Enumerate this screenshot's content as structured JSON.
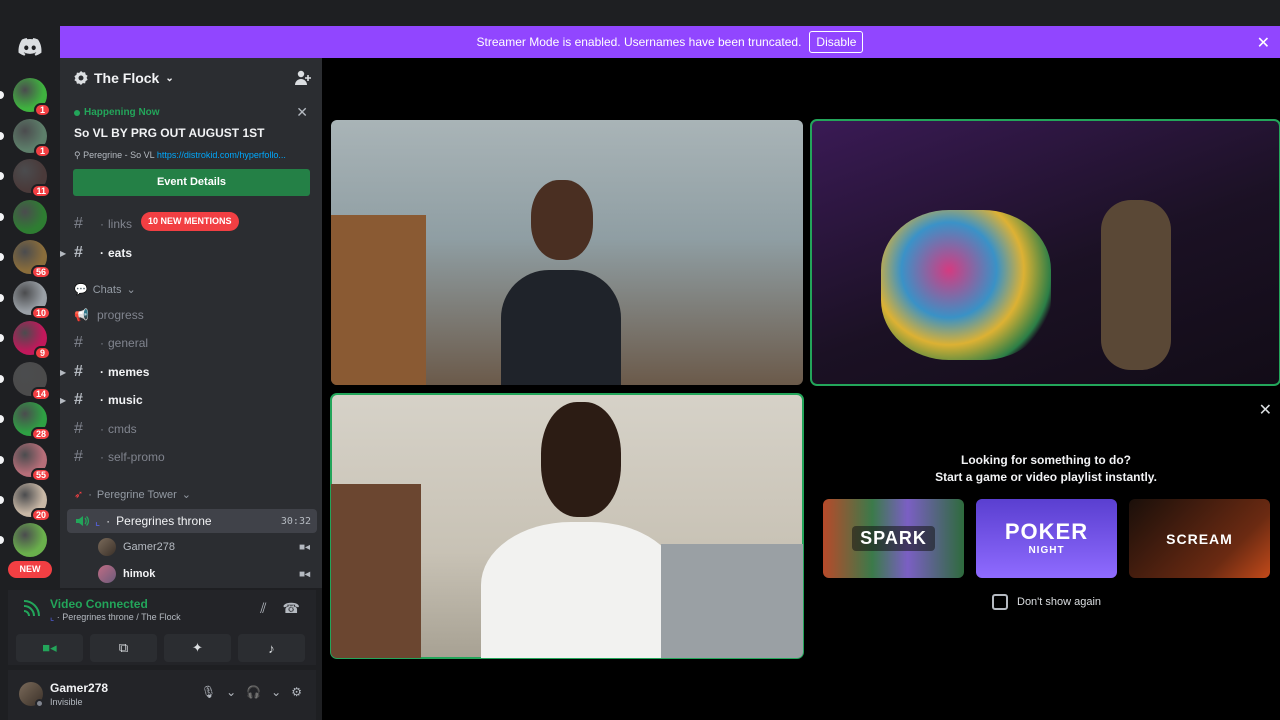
{
  "banner": {
    "text": "Streamer Mode is enabled. Usernames have been truncated.",
    "button": "Disable"
  },
  "servers": [
    {
      "badge": "1",
      "color": "#3fb33f"
    },
    {
      "badge": "1",
      "color": "#5d7e6a"
    },
    {
      "badge": "11",
      "color": "#4a3a3a"
    },
    {
      "badge": "",
      "color": "#2e7d32"
    },
    {
      "badge": "56",
      "color": "#8a6d3b"
    },
    {
      "badge": "10",
      "color": "#9aa0a6"
    },
    {
      "badge": "9",
      "color": "#c2185b"
    },
    {
      "badge": "14",
      "color": "#4b4b4b"
    },
    {
      "badge": "28",
      "color": "#2ea043"
    },
    {
      "badge": "55",
      "color": "#b76e79"
    },
    {
      "badge": "20",
      "color": "#c9b8a6"
    },
    {
      "badge": "",
      "color": "#6ab04c"
    }
  ],
  "new_pill": "NEW",
  "guild": {
    "name": "The Flock"
  },
  "event": {
    "status": "Happening Now",
    "title": "So VL BY PRG OUT AUGUST 1ST",
    "location_prefix": "Peregrine - So VL ",
    "location_link": "https://distrokid.com/hyperfollo...",
    "button": "Event Details"
  },
  "channels_top": [
    {
      "name": "links",
      "bold": false
    },
    {
      "name": "eats",
      "bold": true
    }
  ],
  "mentions_pill": "10 NEW MENTIONS",
  "category_chats": "Chats",
  "channels_chats": [
    {
      "name": "progress",
      "type": "announce",
      "bold": false
    },
    {
      "name": "general",
      "type": "text",
      "bold": false
    },
    {
      "name": "memes",
      "type": "text",
      "bold": true
    },
    {
      "name": "music",
      "type": "text",
      "bold": true
    },
    {
      "name": "cmds",
      "type": "text",
      "bold": false
    },
    {
      "name": "self-promo",
      "type": "text",
      "bold": false
    }
  ],
  "category_voice": "Peregrine Tower",
  "voice_channel": {
    "name": "Peregrines throne",
    "timer": "30:32"
  },
  "voice_users": [
    {
      "name": "Gamer278",
      "bold": false
    },
    {
      "name": "himok",
      "bold": true
    }
  ],
  "voice_panel": {
    "title": "Video Connected",
    "subtitle": "Peregrines throne / The Flock"
  },
  "user": {
    "name": "Gamer278",
    "status": "Invisible"
  },
  "activity": {
    "line1": "Looking for something to do?",
    "line2": "Start a game or video playlist instantly.",
    "cards": [
      {
        "title": "SPARK",
        "color": "#2f5a3c"
      },
      {
        "title": "POKER",
        "subtitle": "NIGHT",
        "color": "#6d4fd8"
      },
      {
        "title": "SCREAM",
        "color": "#3a1a10"
      }
    ],
    "dont_show": "Don't show again"
  }
}
